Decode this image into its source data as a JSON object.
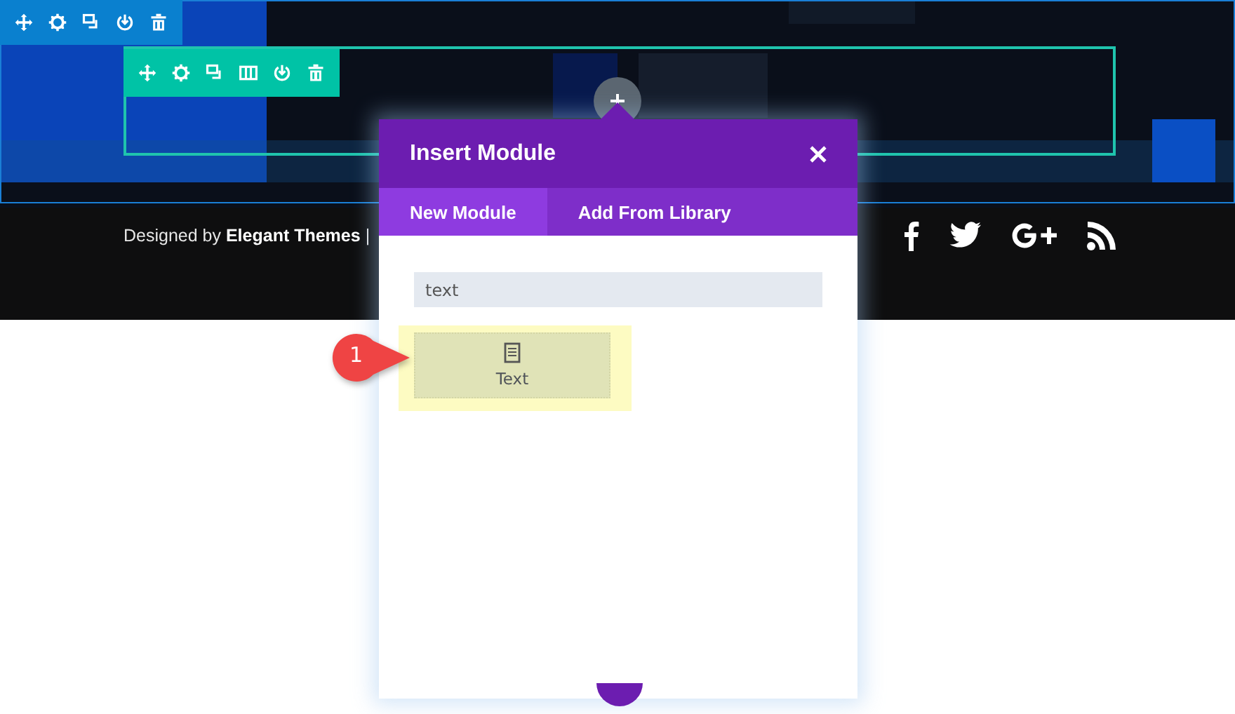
{
  "footer": {
    "credit": "Designed by **Elegant Themes** |"
  },
  "modal": {
    "title": "Insert Module",
    "tabs": [
      {
        "label": "New Module",
        "selected": true
      },
      {
        "label": "Add From Library",
        "selected": false
      }
    ],
    "search": {
      "value": "text"
    },
    "modules": [
      {
        "label": "Text",
        "highlighted": true
      }
    ]
  },
  "callout": {
    "number": "1"
  }
}
